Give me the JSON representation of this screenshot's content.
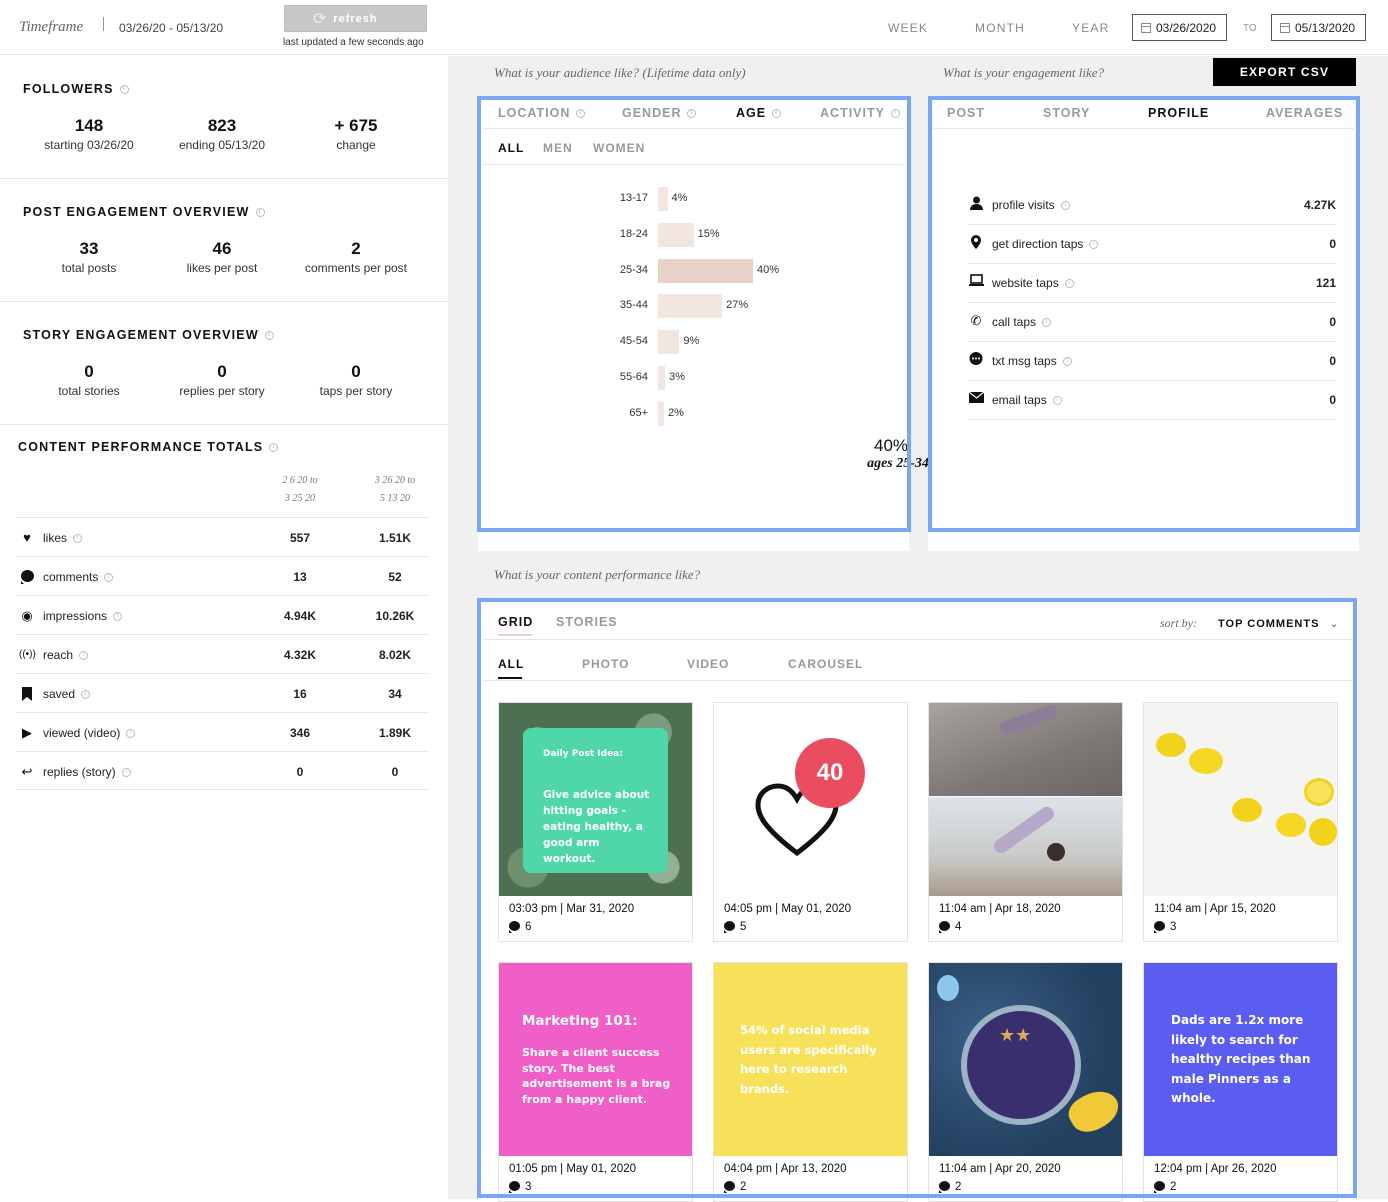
{
  "header": {
    "timeframe_label": "Timeframe",
    "range": "03/26/20 - 05/13/20",
    "refresh_label": "refresh",
    "last_updated": "last updated a few seconds ago",
    "periods": [
      "WEEK",
      "MONTH",
      "YEAR"
    ],
    "date_from": "03/26/2020",
    "to_label": "TO",
    "date_to": "05/13/2020"
  },
  "followers": {
    "title": "FOLLOWERS",
    "stats": [
      {
        "value": "148",
        "label": "starting 03/26/20"
      },
      {
        "value": "823",
        "label": "ending 05/13/20"
      },
      {
        "value": "+ 675",
        "label": "change"
      }
    ]
  },
  "post_engagement": {
    "title": "POST ENGAGEMENT OVERVIEW",
    "stats": [
      {
        "value": "33",
        "label": "total posts"
      },
      {
        "value": "46",
        "label": "likes per post"
      },
      {
        "value": "2",
        "label": "comments per post"
      }
    ]
  },
  "story_engagement": {
    "title": "STORY ENGAGEMENT OVERVIEW",
    "stats": [
      {
        "value": "0",
        "label": "total stories"
      },
      {
        "value": "0",
        "label": "replies per story"
      },
      {
        "value": "0",
        "label": "taps per story"
      }
    ]
  },
  "content_totals": {
    "title": "CONTENT PERFORMANCE TOTALS",
    "col1": [
      "2 6 20 to",
      "3 25 20"
    ],
    "col2": [
      "3 26 20 to",
      "5 13 20"
    ],
    "rows": [
      {
        "icon": "heart-icon",
        "label": "likes",
        "v1": "557",
        "v2": "1.51K"
      },
      {
        "icon": "comment-icon",
        "label": "comments",
        "v1": "13",
        "v2": "52"
      },
      {
        "icon": "eye-icon",
        "label": "impressions",
        "v1": "4.94K",
        "v2": "10.26K"
      },
      {
        "icon": "broadcast-icon",
        "label": "reach",
        "v1": "4.32K",
        "v2": "8.02K"
      },
      {
        "icon": "bookmark-icon",
        "label": "saved",
        "v1": "16",
        "v2": "34"
      },
      {
        "icon": "play-icon",
        "label": "viewed (video)",
        "v1": "346",
        "v2": "1.89K"
      },
      {
        "icon": "reply-icon",
        "label": "replies (story)",
        "v1": "0",
        "v2": "0"
      }
    ]
  },
  "audience": {
    "question": "What is your audience like? (Lifetime data only)",
    "tabs": [
      "LOCATION",
      "GENDER",
      "AGE",
      "ACTIVITY"
    ],
    "active_tab": "AGE",
    "subtabs": [
      "ALL",
      "MEN",
      "WOMEN"
    ],
    "active_subtab": "ALL",
    "highlight_value": "40%",
    "highlight_text": "ages 25-34"
  },
  "chart_data": {
    "type": "bar",
    "orientation": "horizontal",
    "categories": [
      "13-17",
      "18-24",
      "25-34",
      "35-44",
      "45-54",
      "55-64",
      "65+"
    ],
    "values": [
      4,
      15,
      40,
      27,
      9,
      3,
      2
    ],
    "value_labels": [
      "4%",
      "15%",
      "40%",
      "27%",
      "9%",
      "3%",
      "2%"
    ],
    "unit": "%",
    "highlight_index": 2,
    "bar_color": "#f3e6e1",
    "highlight_color": "#e8d1c6"
  },
  "engagement": {
    "question": "What is your engagement like?",
    "export_label": "EXPORT CSV",
    "tabs": [
      "POST",
      "STORY",
      "PROFILE",
      "AVERAGES"
    ],
    "active_tab": "PROFILE",
    "rows": [
      {
        "icon": "person-icon",
        "label": "profile visits",
        "value": "4.27K"
      },
      {
        "icon": "map-pin-icon",
        "label": "get direction taps",
        "value": "0"
      },
      {
        "icon": "laptop-icon",
        "label": "website taps",
        "value": "121"
      },
      {
        "icon": "phone-icon",
        "label": "call taps",
        "value": "0"
      },
      {
        "icon": "chat-icon",
        "label": "txt msg taps",
        "value": "0"
      },
      {
        "icon": "envelope-icon",
        "label": "email taps",
        "value": "0"
      }
    ]
  },
  "content": {
    "question": "What is your content performance like?",
    "tabs": [
      "GRID",
      "STORIES"
    ],
    "active_tab": "GRID",
    "sort_label": "sort by:",
    "sort_value": "TOP COMMENTS",
    "filters": [
      "ALL",
      "PHOTO",
      "VIDEO",
      "CAROUSEL"
    ],
    "active_filter": "ALL",
    "posts": [
      {
        "timestamp": "03:03 pm | Mar 31, 2020",
        "comments": "6",
        "kind": "daily-post-idea",
        "title": "Daily Post Idea:",
        "text": "Give advice about hitting goals - eating healthy, a good arm workout."
      },
      {
        "timestamp": "04:05 pm | May 01, 2020",
        "comments": "5",
        "kind": "heart-badge",
        "badge": "40"
      },
      {
        "timestamp": "11:04 am | Apr 18, 2020",
        "comments": "4",
        "kind": "yoga-photo"
      },
      {
        "timestamp": "11:04 am | Apr 15, 2020",
        "comments": "3",
        "kind": "lemons-photo"
      },
      {
        "timestamp": "01:05 pm | May 01, 2020",
        "comments": "3",
        "kind": "marketing-101",
        "title": "Marketing 101:",
        "text": "Share a client success story. The best advertisement is a brag from a happy client."
      },
      {
        "timestamp": "04:04 pm | Apr 13, 2020",
        "comments": "2",
        "kind": "social-media-stat",
        "text": "54% of social media users are specifically here to research brands."
      },
      {
        "timestamp": "11:04 am | Apr 20, 2020",
        "comments": "2",
        "kind": "smoothie-bowl-photo"
      },
      {
        "timestamp": "12:04 pm | Apr 26, 2020",
        "comments": "2",
        "kind": "dads-stat",
        "text": "Dads are 1.2x more likely to search for healthy recipes than male Pinners as a whole."
      }
    ]
  },
  "colors": {
    "outline": "#7aa6f2",
    "teal": "#4fd7aa",
    "pink": "#f05ec8",
    "yellow": "#f7e15a",
    "purple": "#5b5cf0",
    "badge_red": "#ea4d5f"
  }
}
